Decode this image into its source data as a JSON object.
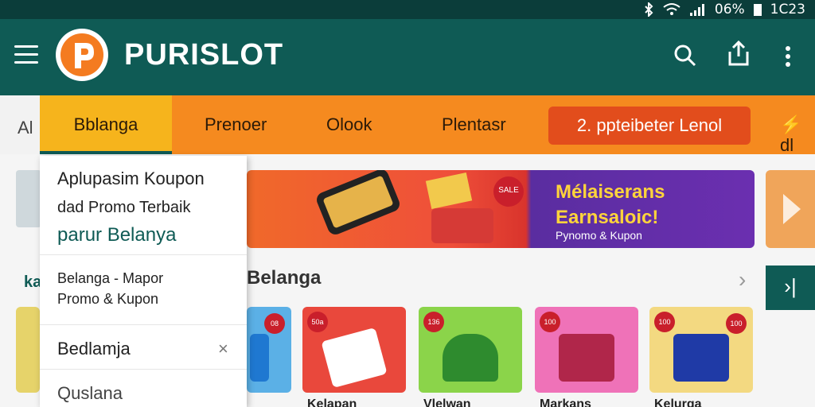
{
  "status": {
    "battery": "06%",
    "time": "1C23"
  },
  "app": {
    "brand": "PURISLOT"
  },
  "nav": {
    "left_clip": "Al",
    "tabs": [
      "Bblanga",
      "Prenoer",
      "Olook",
      "Plentasr"
    ],
    "pill": "2. ppteibeter Lenol",
    "edge": "⚡ dl"
  },
  "banner": {
    "title": "Mélaiserans Earnsaloic!",
    "subtitle": "Pynomo & Kupon",
    "badge": "SALE"
  },
  "section": {
    "title": "Belanga",
    "left_clip": "ka"
  },
  "dropdown": {
    "title": "Aplupasim Koupon",
    "line2": "dad Promo Terbaik",
    "line3": "parur Belanya",
    "sub1": "Belanga - Mapor",
    "sub2": "Promo & Kupon",
    "item1": "Bedlamja",
    "item1_close": "×",
    "item2": "Quslana"
  },
  "cards": [
    {
      "badge": "08",
      "color": "#5bb0e6",
      "thing": "#1f78d1",
      "caption": ""
    },
    {
      "badge": "50a",
      "color": "#e9483c",
      "thing": "#ffffff",
      "caption": "Kelapan"
    },
    {
      "badge": "136",
      "color": "#8bd44a",
      "thing": "#2e8b2e",
      "caption": "Vlelwan"
    },
    {
      "badge": "100",
      "color": "#ef72b8",
      "thing": "#b0264a",
      "caption": "Markans"
    },
    {
      "badge": "100",
      "color": "#f3d981",
      "thing": "#1f3aa6",
      "caption": "Kelurga"
    }
  ],
  "icons": {
    "menu": "menu-icon",
    "search": "search-icon",
    "share": "share-icon",
    "more": "more-vertical-icon"
  }
}
